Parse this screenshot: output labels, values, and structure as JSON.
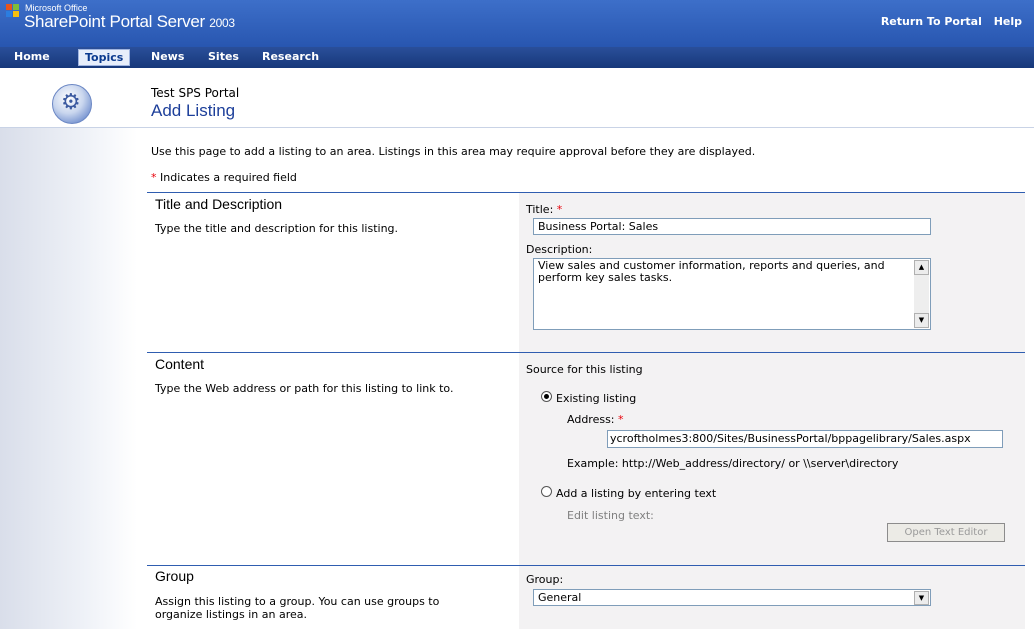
{
  "header": {
    "brand_small": "Microsoft Office",
    "brand_main": "SharePoint Portal Server",
    "brand_version": "2003",
    "links": [
      "Return To Portal",
      "Help"
    ],
    "colors": {
      "header": "#2f60bd",
      "nav": "#1e4189",
      "accent_rule": "#2f5db0",
      "required": "#e8000a"
    }
  },
  "nav": {
    "items": [
      "Home",
      "Topics",
      "News",
      "Sites",
      "Research"
    ],
    "active": "Topics"
  },
  "page": {
    "portal": "Test SPS Portal",
    "title": "Add Listing",
    "icon": "gears-icon",
    "intro": "Use this page to add a listing to an area. Listings in this area may require approval before they are displayed.",
    "required_note": "Indicates a required field",
    "required_mark": "*"
  },
  "sections": {
    "title_desc": {
      "heading": "Title and Description",
      "description": "Type the title and description for this listing.",
      "title_label": "Title:",
      "title_value": "Business Portal: Sales",
      "desc_label": "Description:",
      "desc_value": "View sales and customer information, reports and queries, and perform key sales tasks."
    },
    "content": {
      "heading": "Content",
      "description": "Type the Web address or path for this listing to link to.",
      "source_label": "Source for this listing",
      "existing_label": "Existing listing",
      "address_label": "Address:",
      "address_value": "ycroftholmes3:800/Sites/BusinessPortal/bppagelibrary/Sales.aspx",
      "example": "Example: http://Web_address/directory/ or \\\\server\\directory",
      "text_option_label": "Add a listing by entering text",
      "edit_text_label": "Edit listing text:",
      "editor_button": "Open Text Editor",
      "selected": "Existing listing"
    },
    "group": {
      "heading": "Group",
      "description": "Assign this listing to a group. You can use groups to organize listings in an area.",
      "group_label": "Group:",
      "group_value": "General"
    }
  }
}
